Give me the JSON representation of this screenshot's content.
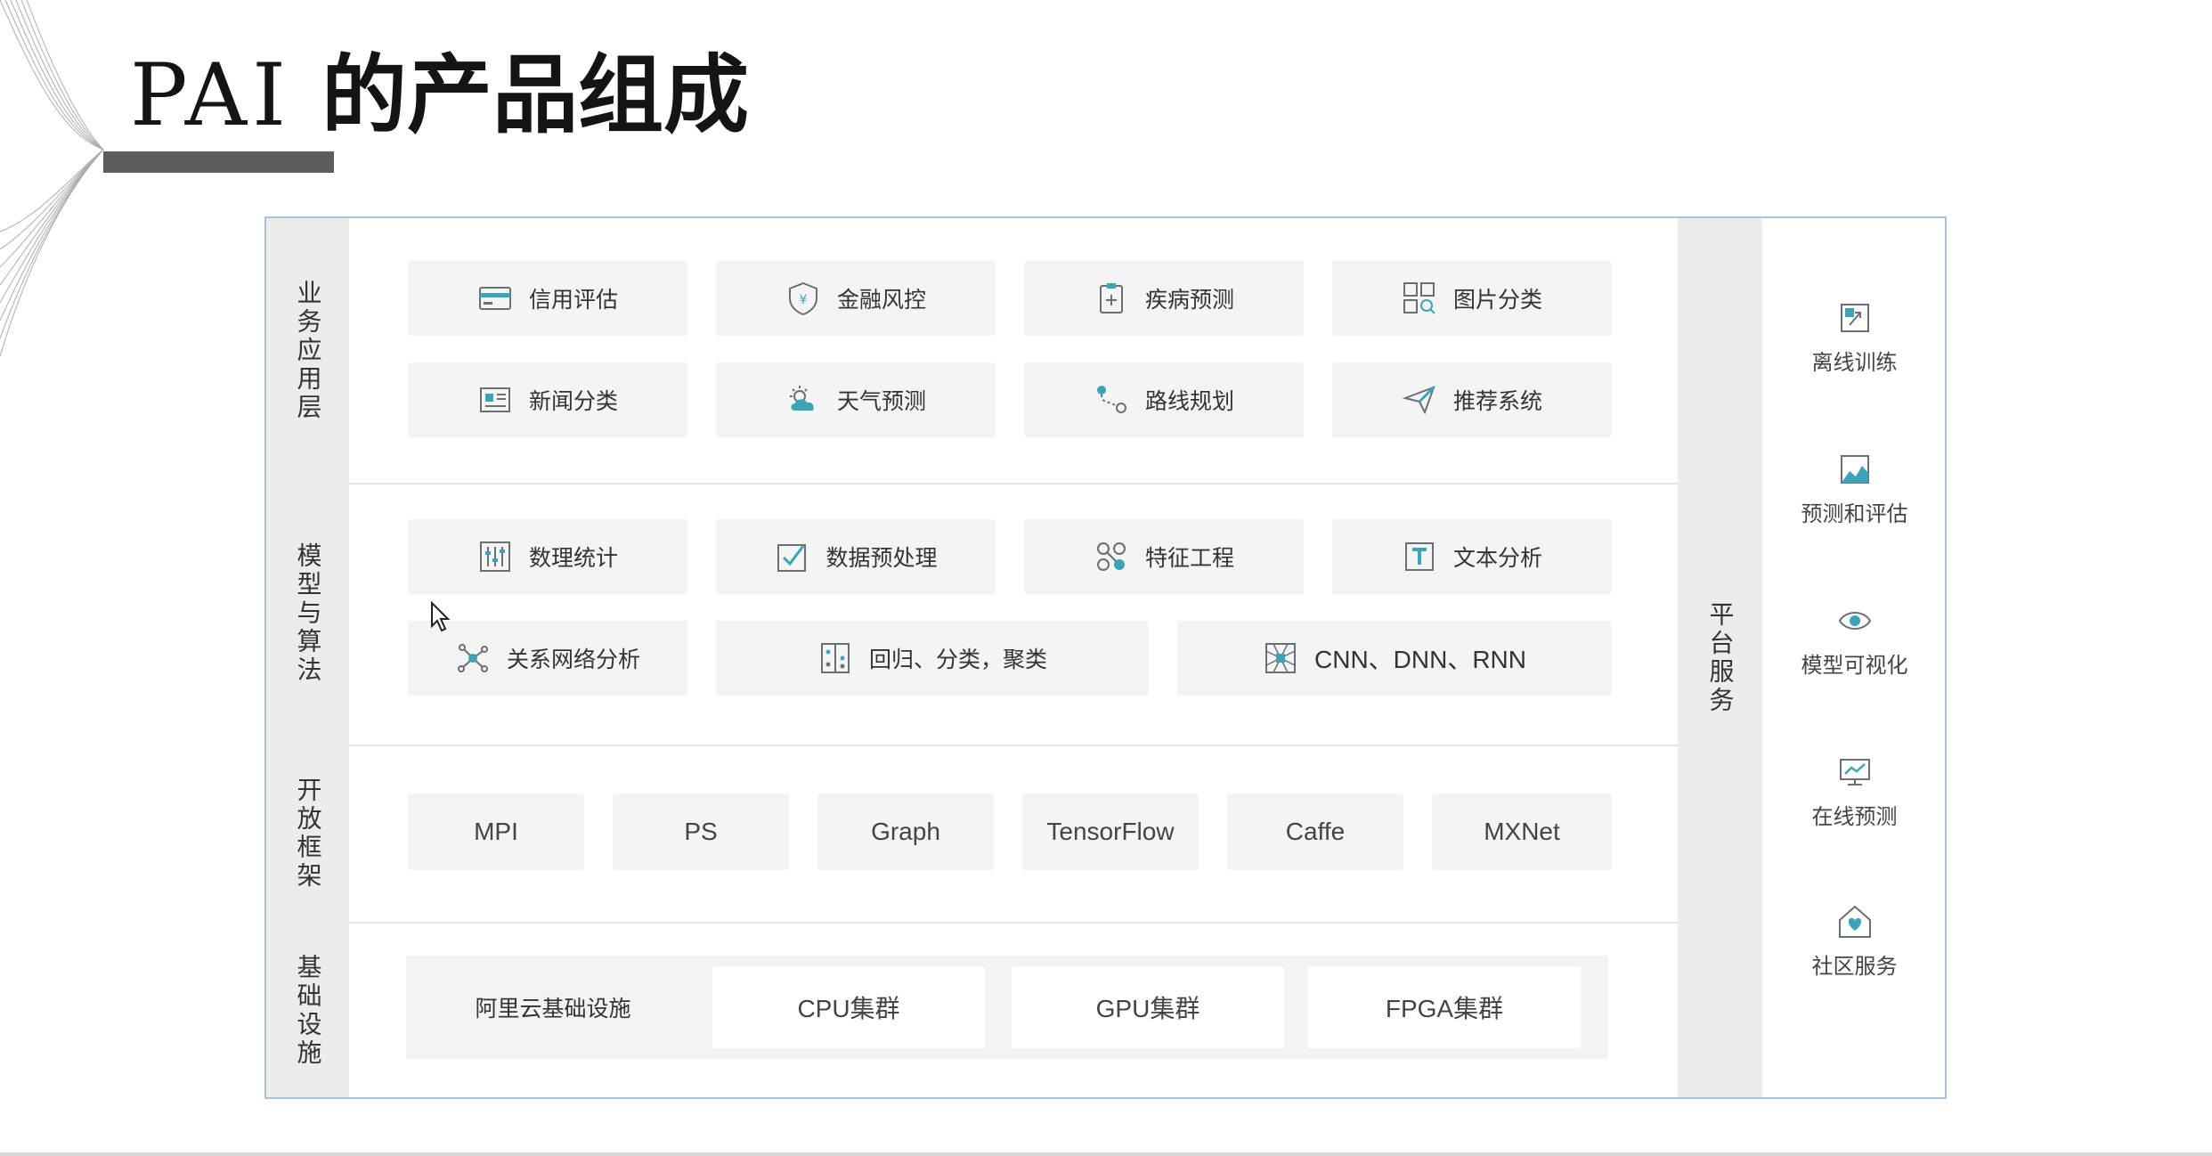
{
  "slide": {
    "title_latin": "PAI",
    "title_cjk": "的产品组成"
  },
  "layers": {
    "business": "业务应用层",
    "model": "模型与算法",
    "framework": "开放框架",
    "infrastructure": "基础设施",
    "platform": "平台服务"
  },
  "business_apps": [
    {
      "label": "信用评估",
      "icon": "credit-card-icon"
    },
    {
      "label": "金融风控",
      "icon": "shield-yen-icon"
    },
    {
      "label": "疾病预测",
      "icon": "medical-clipboard-icon"
    },
    {
      "label": "图片分类",
      "icon": "image-grid-search-icon"
    },
    {
      "label": "新闻分类",
      "icon": "newspaper-icon"
    },
    {
      "label": "天气预测",
      "icon": "weather-cloud-sun-icon"
    },
    {
      "label": "路线规划",
      "icon": "route-pin-icon"
    },
    {
      "label": "推荐系统",
      "icon": "paper-plane-icon"
    }
  ],
  "algorithms": [
    {
      "label": "数理统计",
      "icon": "sliders-icon"
    },
    {
      "label": "数据预处理",
      "icon": "check-doc-icon"
    },
    {
      "label": "特征工程",
      "icon": "feature-nodes-icon"
    },
    {
      "label": "文本分析",
      "icon": "text-frame-icon"
    },
    {
      "label": "关系网络分析",
      "icon": "network-graph-icon"
    },
    {
      "label": "回归、分类，聚类",
      "icon": "cluster-grid-icon"
    },
    {
      "label": "CNN、DNN、RNN",
      "icon": "neural-net-icon"
    }
  ],
  "frameworks": [
    "MPI",
    "PS",
    "Graph",
    "TensorFlow",
    "Caffe",
    "MXNet"
  ],
  "infrastructure": [
    "阿里云基础设施",
    "CPU集群",
    "GPU集群",
    "FPGA集群"
  ],
  "platform_services": [
    {
      "label": "离线训练",
      "icon": "offline-training-icon"
    },
    {
      "label": "预测和评估",
      "icon": "chart-evaluate-icon"
    },
    {
      "label": "模型可视化",
      "icon": "eye-icon"
    },
    {
      "label": "在线预测",
      "icon": "monitor-chart-icon"
    },
    {
      "label": "社区服务",
      "icon": "heart-house-icon"
    }
  ],
  "colors": {
    "accent": "#3ba4b8",
    "icon_stroke": "#6a6f75",
    "frame_border": "#a9c3de",
    "column_bg": "#ececec",
    "tile_bg": "#f4f4f4",
    "title_bar": "#5c5c5c"
  }
}
